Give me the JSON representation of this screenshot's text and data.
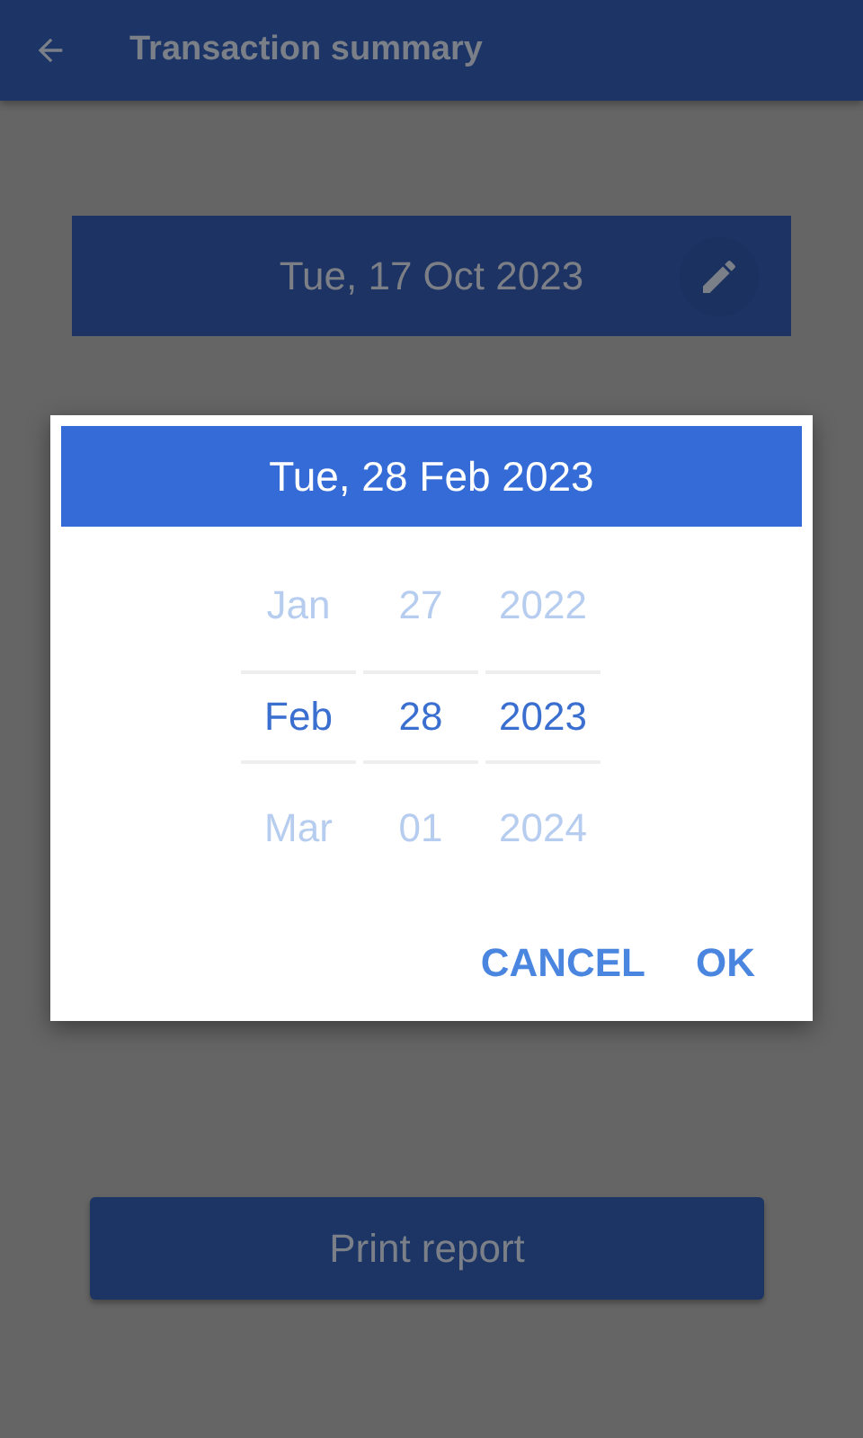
{
  "app_bar": {
    "title": "Transaction summary"
  },
  "date_field": {
    "value": "Tue, 17 Oct 2023"
  },
  "print_button": {
    "label": "Print report"
  },
  "dialog": {
    "header": "Tue, 28 Feb 2023",
    "columns": [
      {
        "items": [
          {
            "label": "Jan",
            "selected": false
          },
          {
            "label": "Feb",
            "selected": true
          },
          {
            "label": "Mar",
            "selected": false
          }
        ]
      },
      {
        "items": [
          {
            "label": "27",
            "selected": false
          },
          {
            "label": "28",
            "selected": true
          },
          {
            "label": "01",
            "selected": false
          }
        ]
      },
      {
        "items": [
          {
            "label": "2022",
            "selected": false
          },
          {
            "label": "2023",
            "selected": true
          },
          {
            "label": "2024",
            "selected": false
          }
        ]
      }
    ],
    "buttons": [
      {
        "label": "CANCEL"
      },
      {
        "label": "OK"
      }
    ]
  }
}
